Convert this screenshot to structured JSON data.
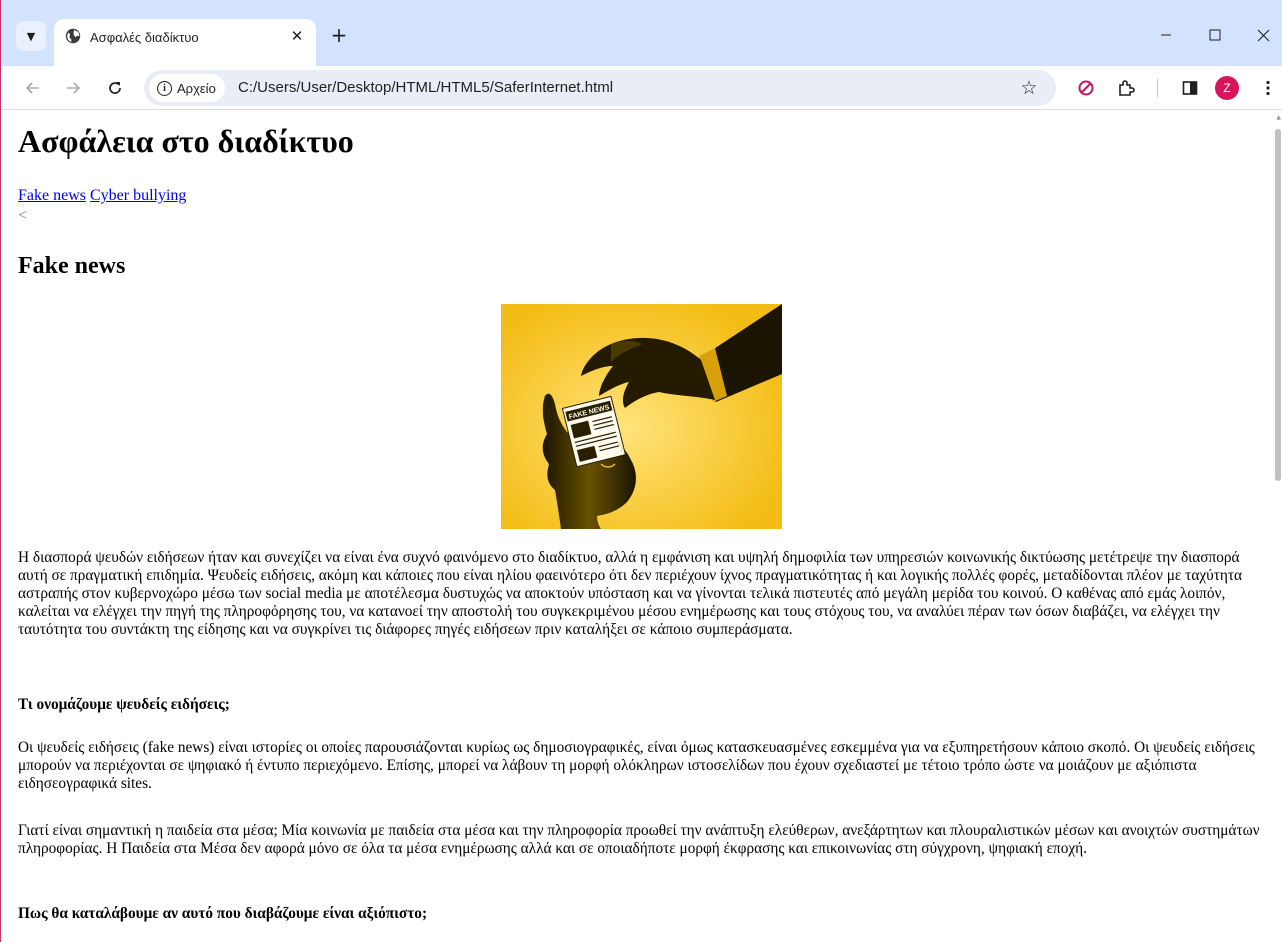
{
  "browser": {
    "tab_title": "Ασφαλές διαδίκτυο",
    "tab_close": "✕",
    "new_tab": "+",
    "address_chip": "Αρχείο",
    "url": "C:/Users/User/Desktop/HTML/HTML5/SaferInternet.html",
    "profile_initial": "Z",
    "accent_color": "#d3e3fd"
  },
  "page": {
    "title": "Ασφάλεια στο διαδίκτυο",
    "nav_links": [
      "Fake news",
      "Cyber bullying"
    ],
    "stray_text": "<",
    "section_heading": "Fake news",
    "image_caption": "FAKE NEWS",
    "paragraphs": [
      "Η διασπορά ψευδών ειδήσεων ήταν και συνεχίζει να είναι ένα συχνό φαινόμενο στο διαδίκτυο, αλλά η εμφάνιση και υψηλή δημοφιλία των υπηρεσιών κοινωνικής δικτύωσης μετέτρεψε την διασπορά αυτή σε πραγματική επιδημία. Ψευδείς ειδήσεις, ακόμη και κάποιες που είναι ηλίου φαεινότερο ότι δεν περιέχουν ίχνος πραγματικότητας ή και λογικής πολλές φορές, μεταδίδονται πλέον με ταχύτητα αστραπής στον κυβερνοχώρο μέσω των social media με αποτέλεσμα δυστυχώς να αποκτούν υπόσταση και να γίνονται τελικά πιστευτές από μεγάλη μερίδα του κοινού. Ο καθένας από εμάς λοιπόν, καλείται να ελέγχει την πηγή της πληροφόρησης του, να κατανοεί την αποστολή του συγκεκριμένου μέσου ενημέρωσης και τους στόχους του, να αναλύει πέραν των όσων διαβάζει, να ελέγχει την ταυτότητα του συντάκτη της είδησης και να συγκρίνει τις διάφορες πηγές ειδήσεων πριν καταλήξει σε κάποιο συμπεράσματα.",
      "Οι ψευδείς ειδήσεις (fake news) είναι ιστορίες οι οποίες παρουσιάζονται κυρίως ως δημοσιογραφικές, είναι όμως κατασκευασμένες εσκεμμένα για να εξυπηρετήσουν κάποιο σκοπό. Οι ψευδείς ειδήσεις μπορούν να περιέχονται σε ψηφιακό ή έντυπο περιεχόμενο. Επίσης, μπορεί να λάβουν τη μορφή ολόκληρων ιστοσελίδων που έχουν σχεδιαστεί με τέτοιο τρόπο ώστε να μοιάζουν με αξιόπιστα ειδησεογραφικά sites.",
      "Γιατί είναι σημαντική η παιδεία στα μέσα; Μία κοινωνία με παιδεία στα μέσα και την πληροφορία προωθεί την ανάπτυξη ελεύθερων, ανεξάρτητων και πλουραλιστικών μέσων και ανοιχτών συστημάτων πληροφορίας. Η Παιδεία στα Μέσα δεν αφορά μόνο σε όλα τα μέσα ενημέρωσης αλλά και σε οποιαδήποτε μορφή έκφρασης και επικοινωνίας στη σύγχρονη, ψηφιακή εποχή."
    ],
    "subheadings": [
      "Τι ονομάζουμε ψευδείς ειδήσεις;",
      "Πως θα καταλάβουμε αν αυτό που διαβάζουμε είναι αξιόπιστο;"
    ]
  }
}
